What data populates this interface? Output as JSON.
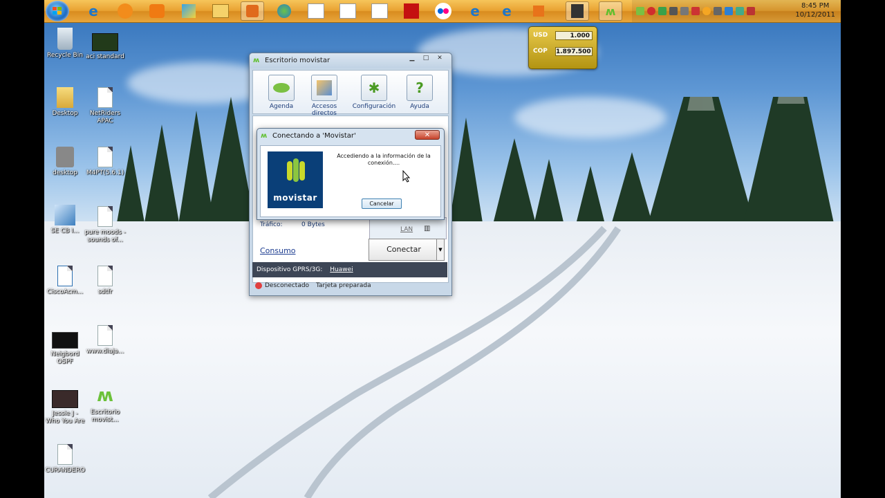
{
  "taskbar": {
    "clock_time": "8:45 PM",
    "clock_date": "10/12/2011"
  },
  "desktop_icons": [
    {
      "label": "Recycle Bin"
    },
    {
      "label": "aci standard"
    },
    {
      "label": "Desktop"
    },
    {
      "label": "NetRiders APAC"
    },
    {
      "label": "desktop"
    },
    {
      "label": "M4PT(5.6.1)"
    },
    {
      "label": "SE CB I..."
    },
    {
      "label": "pure moods - sounds of..."
    },
    {
      "label": "CiscoAcm..."
    },
    {
      "label": "sdtfr"
    },
    {
      "label": "Neigbord OSPF"
    },
    {
      "label": "www.diaja..."
    },
    {
      "label": "Jessie J - Who You Are"
    },
    {
      "label": "Escritorio movist..."
    },
    {
      "label": "CURANDERO"
    }
  ],
  "currency_gadget": {
    "from_code": "USD",
    "from_value": "1.000",
    "to_code": "COP",
    "to_value": "1.897.500"
  },
  "main_window": {
    "title": "Escritorio movistar",
    "toolbar": {
      "agenda": "Agenda",
      "accesos": "Accesos directos",
      "config": "Configuración",
      "ayuda": "Ayuda"
    },
    "traffic_label": "Tráfico:",
    "traffic_value": "0 Bytes",
    "lan_label": "LAN",
    "consumo_link": "Consumo",
    "connect_label": "Conectar",
    "device_label": "Dispositivo GPRS/3G:",
    "device_value": "Huawei",
    "status_left": "Desconectado",
    "status_right": "Tarjeta preparada"
  },
  "dialog": {
    "title": "Conectando a 'Movistar'",
    "close": "✕",
    "message": "Accediendo a la información de la conexión....",
    "cancel": "Cancelar",
    "logo_text": "movistar"
  }
}
